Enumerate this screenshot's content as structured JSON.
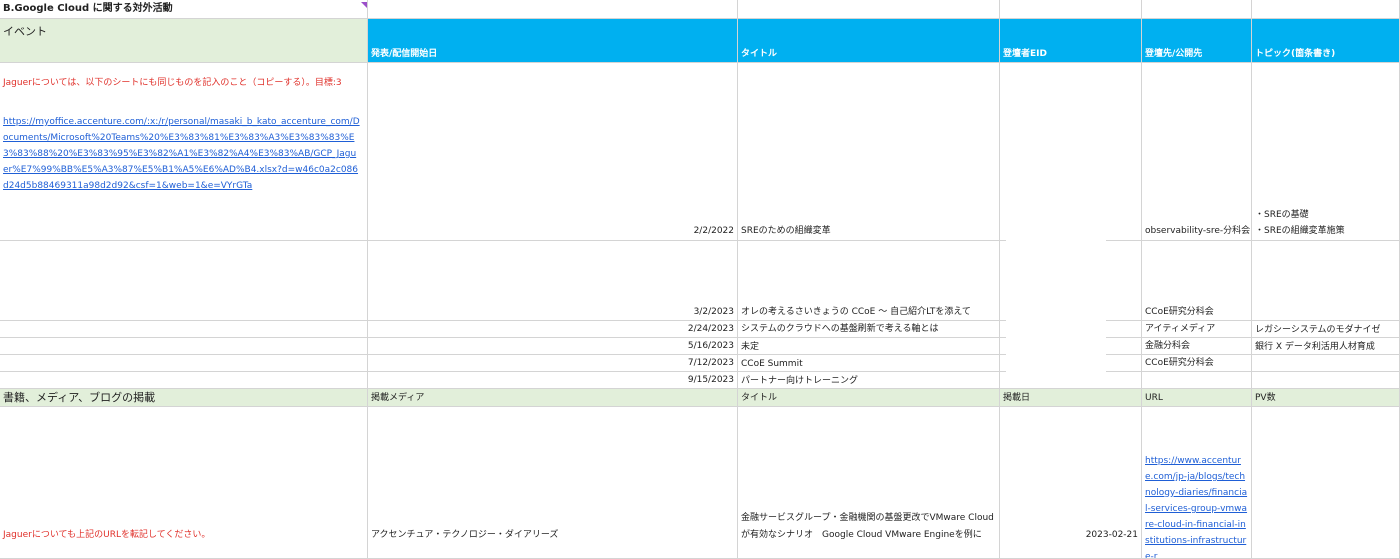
{
  "section_title": "B.Google Cloud に関する対外活動",
  "events": {
    "label": "イベント",
    "headers": [
      "発表/配信開始日",
      "タイトル",
      "登壇者EID",
      "登壇先/公開先",
      "トピック(箇条書き)"
    ],
    "note": "Jaguerについては、以下のシートにも同じものを記入のこと（コピーする）。目標:3",
    "link": "https://myoffice.accenture.com/:x:/r/personal/masaki_b_kato_accenture_com/Documents/Microsoft%20Teams%20%E3%83%81%E3%83%A3%E3%83%83%E3%83%88%20%E3%83%95%E3%82%A1%E3%82%A4%E3%83%AB/GCP_Jaguer%E7%99%BB%E5%A3%87%E5%B1%A5%E6%AD%B4.xlsx?d=w46c0a2c086d24d5b88469311a98d2d92&csf=1&web=1&e=VYrGTa",
    "rows": [
      {
        "date": "2/2/2022",
        "title": "SREのための組織変革",
        "eid": "",
        "venue": "observability-sre-分科会",
        "topic1": "・SREの基礎",
        "topic2": "・SREの組織変革施策"
      },
      {
        "date": "3/2/2023",
        "title": "オレの考えるさいきょうの CCoE ～ 自己紹介LTを添えて",
        "eid": "",
        "venue": "CCoE研究分科会",
        "topic1": "",
        "topic2": ""
      },
      {
        "date": "2/24/2023",
        "title": "システムのクラウドへの基盤刷新で考える軸とは",
        "eid": "",
        "venue": "アイティメディア",
        "topic1": "レガシーシステムのモダナイゼ",
        "topic2": ""
      },
      {
        "date": "5/16/2023",
        "title": "未定",
        "eid": "",
        "venue": "金融分科会",
        "topic1": "銀行 X データ利活用人材育成",
        "topic2": ""
      },
      {
        "date": "7/12/2023",
        "title": "CCoE Summit",
        "eid": "",
        "venue": "CCoE研究分科会",
        "topic1": "",
        "topic2": ""
      },
      {
        "date": "9/15/2023",
        "title": "パートナー向けトレーニング",
        "eid": "",
        "venue": "",
        "topic1": "",
        "topic2": ""
      }
    ]
  },
  "media": {
    "label": "書籍、メディア、ブログの掲載",
    "headers": [
      "掲載メディア",
      "タイトル",
      "掲載日",
      "URL",
      "PV数"
    ],
    "note": "Jaguerについても上記のURLを転記してください。",
    "row": {
      "outlet": "アクセンチュア・テクノロジー・ダイアリーズ",
      "title": "金融サービスグループ・金融機関の基盤更改でVMware Cloudが有効なシナリオ　Google Cloud VMware Engineを例に",
      "date": "2023-02-21",
      "url": "https://www.accenture.com/jp-ja/blogs/technology-diaries/financial-services-group-vmware-cloud-in-financial-institutions-infrastructure-r",
      "pv": ""
    }
  },
  "colors": {
    "header_blue": "#00b0f0",
    "label_green": "#e2efda",
    "note_red": "#e0312b",
    "link_blue": "#1f5fd6"
  }
}
